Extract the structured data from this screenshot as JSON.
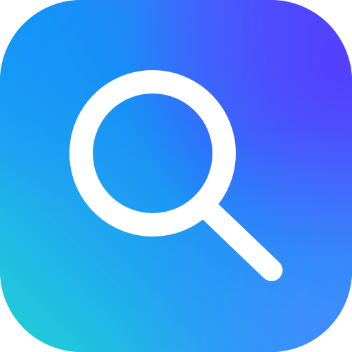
{
  "icon": {
    "name": "search-icon",
    "glyph_color": "#ffffff",
    "gradient_colors": [
      "#22d3d6",
      "#1a8df7",
      "#4a4cfc",
      "#3f86fd"
    ]
  }
}
